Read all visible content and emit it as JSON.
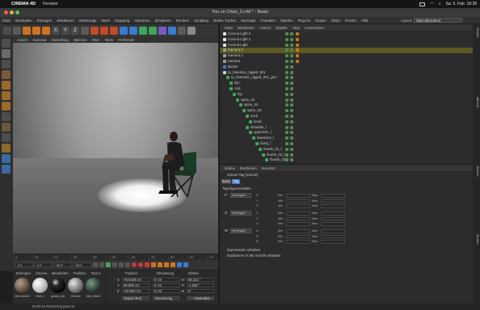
{
  "macos_menu": {
    "apple": "",
    "items": [
      "CINEMA 4D",
      "Fenster"
    ]
  },
  "macos_status": {
    "datetime": "Sa. 5. Feb. 18:39"
  },
  "window": {
    "title": "You on Chair_2.c4d * - Basis"
  },
  "main_menu": {
    "items": [
      "Datei",
      "Bearbeiten",
      "Erzeugen",
      "Selektieren",
      "Werkzeuge",
      "Mesh",
      "Snapping",
      "Animieren",
      "Simulieren",
      "Rendern",
      "Sculpting",
      "Motion Tracker",
      "MoGraph",
      "Charakter",
      "Pipeline",
      "Plug-ins",
      "Octane",
      "Skript",
      "Fenster",
      "Hilfe"
    ]
  },
  "layout": {
    "label": "Layout:",
    "value": "Start (Benutzer)"
  },
  "viewport": {
    "menu": [
      "Ansicht",
      "Kameras",
      "Darstellung",
      "Optionen",
      "Filter",
      "Tafeln",
      "ProRender"
    ]
  },
  "timeline": {
    "ticks": [
      "0",
      "10",
      "20",
      "30",
      "40",
      "50",
      "60",
      "70",
      "80",
      "90"
    ],
    "end_frame": "0 F"
  },
  "playback": {
    "start": "0 F",
    "current": "0 F",
    "end": "90 F",
    "end2": "90 F"
  },
  "materials": {
    "menu": [
      "Erzeugen",
      "Cinema",
      "Bearbeiten",
      "Funktion",
      "Textur"
    ],
    "items": [
      "Mat.Gesich",
      "Mat.1",
      "glossy_dia",
      "Chrome",
      "Mat_Wand"
    ]
  },
  "coords": {
    "headers": [
      "Position",
      "Abmessung",
      "Winkel"
    ],
    "rows": [
      {
        "axis": "X",
        "pos": "704.839 cm",
        "size": "0 cm",
        "rot_axis": "H",
        "rot": "89.224 °"
      },
      {
        "axis": "Y",
        "pos": "98.908 cm",
        "size": "0 cm",
        "rot_axis": "P",
        "rot": "-1.582 °"
      },
      {
        "axis": "Z",
        "pos": "-53.894 cm",
        "size": "0 cm",
        "rot_axis": "B",
        "rot": "0 °"
      }
    ],
    "mode": "Objekt (Rel)",
    "mode2": "Abmessung",
    "apply": "Anwenden"
  },
  "status": {
    "text": "00:00:13 Rendering pass 31"
  },
  "object_manager": {
    "tabs": [
      "Datei",
      "Bearbeiten",
      "Ansicht",
      "Objekte",
      "Tags",
      "Lesezeichen"
    ],
    "objects": [
      {
        "name": "Corona Light.2",
        "indent": 0,
        "icon": "light"
      },
      {
        "name": "Corona Light.1",
        "indent": 0,
        "icon": "light"
      },
      {
        "name": "Corona Light",
        "indent": 0,
        "icon": "light"
      },
      {
        "name": "Kamera.2",
        "indent": 0,
        "icon": "camera",
        "highlight": true
      },
      {
        "name": "Kamera.1",
        "indent": 0,
        "icon": "camera"
      },
      {
        "name": "Kamera",
        "indent": 0,
        "icon": "camera"
      },
      {
        "name": "Boden",
        "indent": 0,
        "icon": "floor"
      },
      {
        "name": "rp_branston_rigged_001",
        "indent": 0,
        "icon": "null"
      },
      {
        "name": "rp_branston_rigged_001_geo",
        "indent": 1,
        "icon": "poly"
      },
      {
        "name": "Ikin",
        "indent": 2,
        "icon": "joint"
      },
      {
        "name": "root",
        "indent": 2,
        "icon": "joint"
      },
      {
        "name": "hip",
        "indent": 3,
        "icon": "joint"
      },
      {
        "name": "spine_01",
        "indent": 4,
        "icon": "joint"
      },
      {
        "name": "spine_02",
        "indent": 5,
        "icon": "joint"
      },
      {
        "name": "spine_03",
        "indent": 6,
        "icon": "joint"
      },
      {
        "name": "neck",
        "indent": 7,
        "icon": "joint"
      },
      {
        "name": "head",
        "indent": 8,
        "icon": "joint"
      },
      {
        "name": "shoulder_l",
        "indent": 7,
        "icon": "joint"
      },
      {
        "name": "upperarm_l",
        "indent": 8,
        "icon": "joint"
      },
      {
        "name": "lowerarm_l",
        "indent": 9,
        "icon": "joint"
      },
      {
        "name": "hand_l",
        "indent": 10,
        "icon": "joint"
      },
      {
        "name": "thumb_01_l",
        "indent": 11,
        "icon": "joint"
      },
      {
        "name": "thumb_02_l",
        "indent": 12,
        "icon": "joint"
      },
      {
        "name": "thumb_03_l",
        "indent": 13,
        "icon": "joint"
      }
    ]
  },
  "attributes": {
    "tabs": [
      "Modus",
      "Bearbeiten",
      "Benutzer"
    ],
    "tag_name": "Schutz-Tag [Schutz]",
    "subtabs": [
      "Basis",
      "Tag"
    ],
    "section": "Tag-Eigenschaften",
    "groups": [
      {
        "label": "P",
        "mode": "Verriegeln",
        "rows": [
          [
            "X",
            "Min",
            "Max"
          ],
          [
            "Y",
            "Min",
            "Max"
          ],
          [
            "Z",
            "Min",
            "Max"
          ]
        ]
      },
      {
        "label": "G",
        "mode": "Verriegeln",
        "rows": [
          [
            "X",
            "Min",
            "Max"
          ],
          [
            "Y",
            "Min",
            "Max"
          ],
          [
            "Z",
            "Min",
            "Max"
          ]
        ]
      },
      {
        "label": "W",
        "mode": "Verriegeln",
        "rows": [
          [
            "H",
            "Min",
            "Max"
          ],
          [
            "P",
            "Min",
            "Max"
          ],
          [
            "B",
            "Min",
            "Max"
          ]
        ]
      }
    ],
    "options": [
      "Rotationen erlauben",
      "Zugriff erlauben vom Manager aus"
    ],
    "checkbox_labels": [
      "Expressions erlauben",
      "Duplizieren in der Ansicht erlauben"
    ]
  },
  "right_strip": {
    "labels": [
      "Objekte",
      "Attribute",
      "Ebenen",
      "Struktur"
    ]
  },
  "colors": {
    "accent": "#4a7fcf",
    "highlight": "#5a5a22",
    "green": "#4f8a4f",
    "orange": "#d0721e"
  }
}
